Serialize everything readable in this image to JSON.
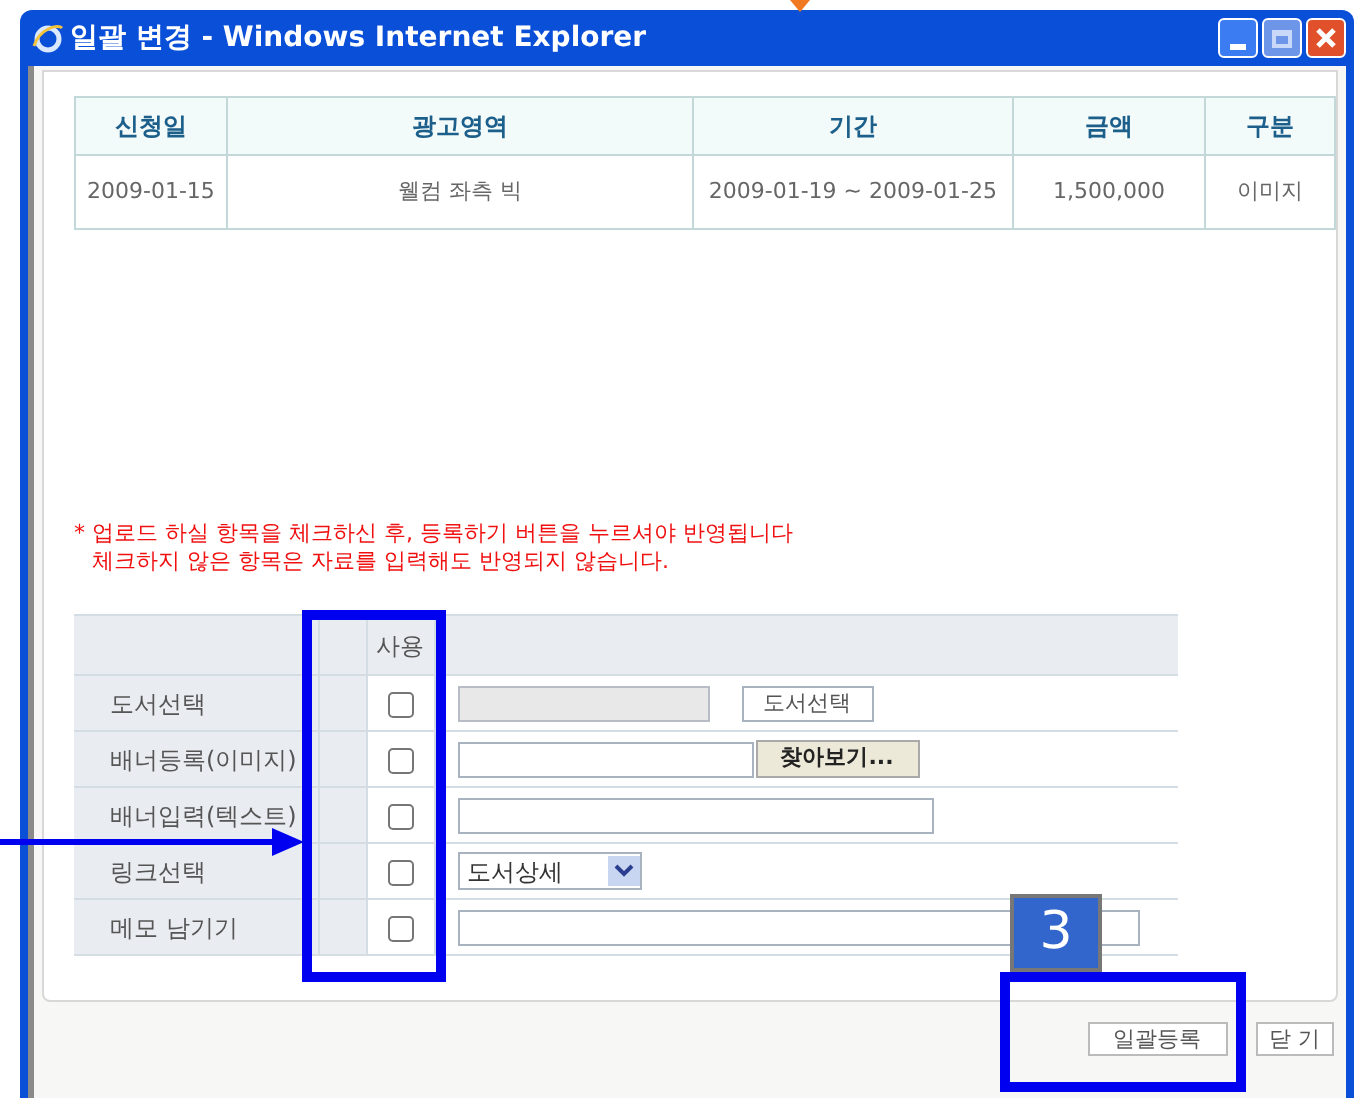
{
  "window": {
    "title": "일괄 변경 - Windows Internet Explorer"
  },
  "table": {
    "columns": [
      "신청일",
      "광고영역",
      "기간",
      "금액",
      "구분"
    ],
    "rows": [
      [
        "2009-01-15",
        "웰컴 좌측 빅",
        "2009-01-19 ~ 2009-01-25",
        "1,500,000",
        "이미지"
      ]
    ]
  },
  "notes": [
    "* 업로드 하실 항목을 체크하신 후, 등록하기 버튼을 누르셔야 반영됩니다",
    "체크하지 않은 항목은 자료를 입력해도 반영되지 않습니다."
  ],
  "form": {
    "use_header": "사용",
    "rows": [
      {
        "label": "도서선택",
        "checked": false,
        "field": {
          "kind": "input-button",
          "disabled": true,
          "button": "도서선택"
        }
      },
      {
        "label": "배너등록(이미지)",
        "checked": false,
        "field": {
          "kind": "file",
          "disabled": false,
          "button": "찾아보기..."
        }
      },
      {
        "label": "배너입력(텍스트)",
        "checked": false,
        "field": {
          "kind": "text",
          "disabled": false
        }
      },
      {
        "label": "링크선택",
        "checked": false,
        "field": {
          "kind": "select",
          "disabled": false,
          "value": "도서상세"
        }
      },
      {
        "label": "메모 남기기",
        "checked": false,
        "field": {
          "kind": "wide",
          "disabled": false
        }
      }
    ]
  },
  "buttons": [
    "일괄등록",
    "닫 기"
  ],
  "annotation": {
    "badge": "3"
  }
}
